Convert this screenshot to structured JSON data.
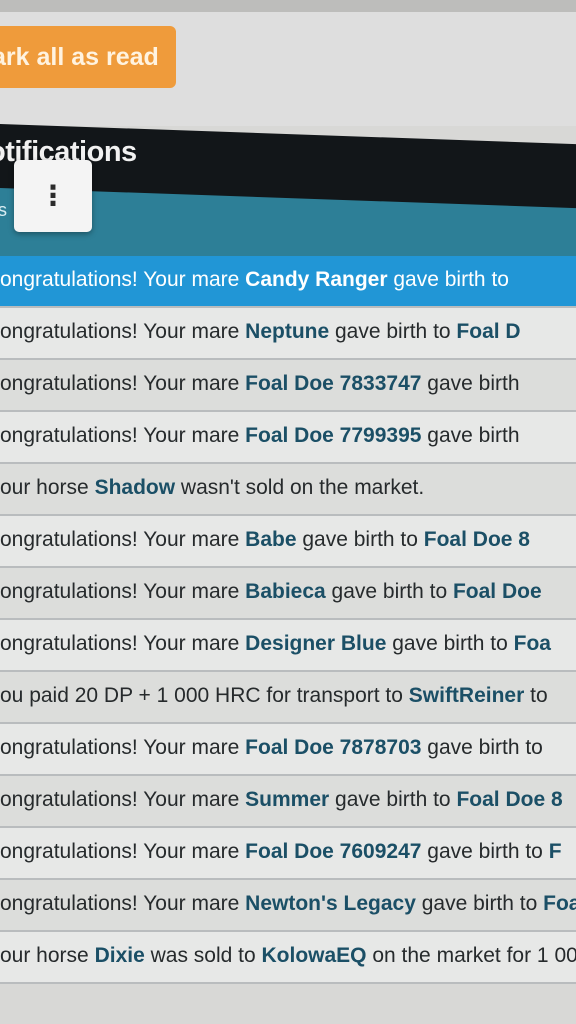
{
  "toolbar": {
    "mark_all_label": "ark all as read"
  },
  "panel": {
    "title": "otifications",
    "tab_label": "s"
  },
  "menu": {
    "icon": "more-vertical-icon",
    "glyph": "⋮"
  },
  "notifications": [
    {
      "pre": "ongratulations! Your mare ",
      "name": "Candy Ranger",
      "post": " gave birth to"
    },
    {
      "pre": "ongratulations! Your mare ",
      "name": "Neptune",
      "post": " gave birth to ",
      "name2": "Foal D"
    },
    {
      "pre": "ongratulations! Your mare ",
      "name": "Foal Doe 7833747",
      "post": " gave birth"
    },
    {
      "pre": "ongratulations! Your mare ",
      "name": "Foal Doe 7799395",
      "post": " gave birth"
    },
    {
      "pre": "our horse ",
      "name": "Shadow",
      "post": " wasn't sold on the market."
    },
    {
      "pre": "ongratulations! Your mare ",
      "name": "Babe",
      "post": " gave birth to ",
      "name2": "Foal Doe 8"
    },
    {
      "pre": "ongratulations! Your mare ",
      "name": "Babieca",
      "post": " gave birth to ",
      "name2": "Foal Doe"
    },
    {
      "pre": "ongratulations! Your mare ",
      "name": "Designer Blue",
      "post": " gave birth to ",
      "name2": "Foa"
    },
    {
      "pre": "ou paid 20 DP + 1 000 HRC for transport to ",
      "name": "SwiftReiner",
      "post": " to"
    },
    {
      "pre": "ongratulations! Your mare ",
      "name": "Foal Doe 7878703",
      "post": " gave birth to"
    },
    {
      "pre": "ongratulations! Your mare ",
      "name": "Summer",
      "post": " gave birth to ",
      "name2": "Foal Doe 8"
    },
    {
      "pre": "ongratulations! Your mare ",
      "name": "Foal Doe 7609247",
      "post": " gave birth to ",
      "name2": "F"
    },
    {
      "pre": "ongratulations! Your mare ",
      "name": "Newton's Legacy",
      "post": " gave birth to ",
      "name2": "Foa"
    },
    {
      "pre": "our horse ",
      "name": "Dixie",
      "post": " was sold to ",
      "name2": "KolowaEQ",
      "post2": " on the market for 1 00"
    }
  ]
}
